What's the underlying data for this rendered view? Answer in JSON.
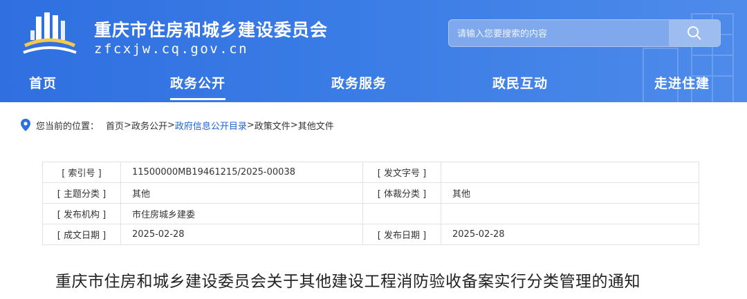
{
  "header": {
    "site_title": "重庆市住房和城乡建设委员会",
    "site_domain": "zfcxjw.cq.gov.cn",
    "search_placeholder": "请输入您要搜索的内容",
    "brand_color": "#3b7de6"
  },
  "nav": {
    "items": [
      {
        "label": "首页"
      },
      {
        "label": "政务公开",
        "active": true
      },
      {
        "label": "政务服务"
      },
      {
        "label": "政民互动"
      },
      {
        "label": "走进住建"
      }
    ]
  },
  "breadcrumb": {
    "label": "您当前的位置：",
    "items": [
      "首页",
      "政务公开",
      "政府信息公开目录",
      "政策文件",
      "其他文件"
    ],
    "separator": ">"
  },
  "meta_table": {
    "rows": [
      {
        "l1": "[ 索引号 ]",
        "v1": "11500000MB19461215/2025-00038",
        "l2": "[ 发文字号 ]",
        "v2": ""
      },
      {
        "l1": "[ 主题分类 ]",
        "v1": "其他",
        "l2": "[ 体裁分类 ]",
        "v2": "其他"
      },
      {
        "l1": "[ 发布机构 ]",
        "v1": "市住房城乡建委",
        "l2": "",
        "v2": ""
      },
      {
        "l1": "[ 成文日期 ]",
        "v1": "2025-02-28",
        "l2": "[ 发布日期 ]",
        "v2": "2025-02-28"
      }
    ]
  },
  "document": {
    "title": "重庆市住房和城乡建设委员会关于其他建设工程消防验收备案实行分类管理的通知"
  }
}
